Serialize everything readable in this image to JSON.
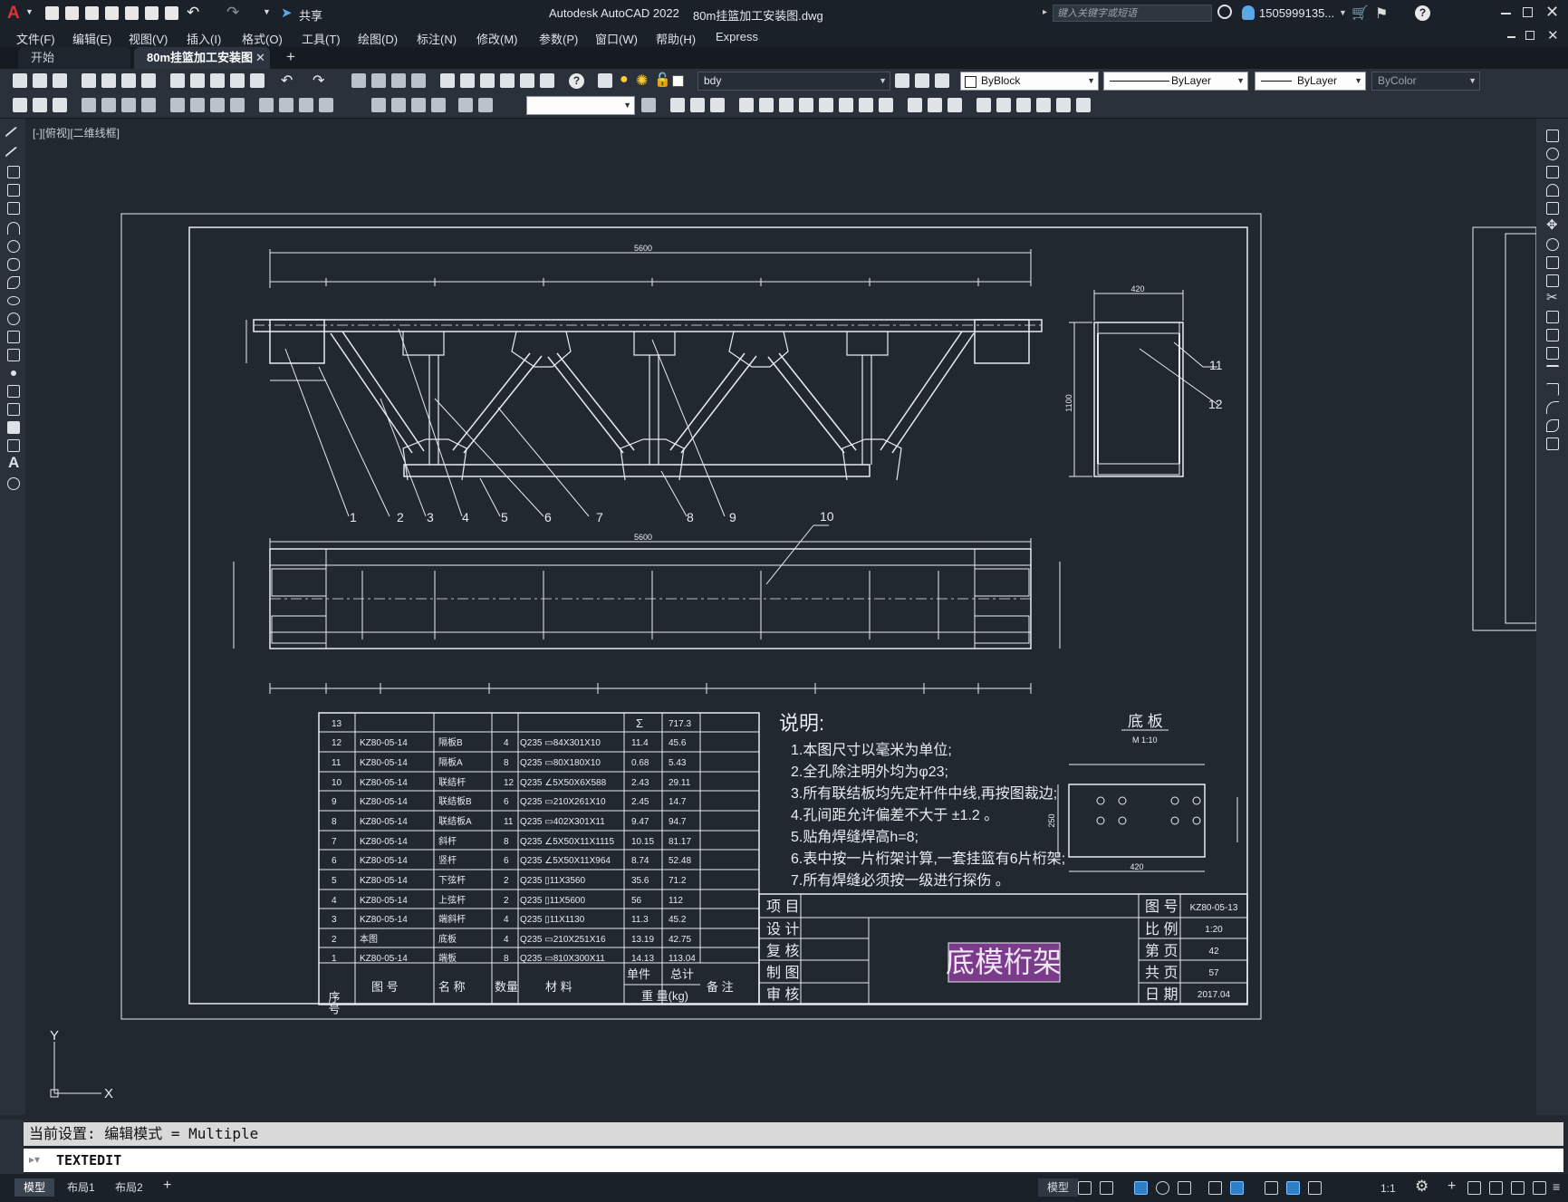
{
  "title_bar": {
    "app_title": "Autodesk AutoCAD 2022",
    "file_name": "80m挂篮加工安装图.dwg",
    "search_placeholder": "键入关键字或短语",
    "user": "1505999135...",
    "share_label": "共享"
  },
  "menu": [
    "文件(F)",
    "编辑(E)",
    "视图(V)",
    "插入(I)",
    "格式(O)",
    "工具(T)",
    "绘图(D)",
    "标注(N)",
    "修改(M)",
    "参数(P)",
    "窗口(W)",
    "帮助(H)",
    "Express"
  ],
  "tabs": {
    "start": "开始",
    "drawing": "80m挂篮加工安装图*"
  },
  "toolbar": {
    "layer_name": "bdy",
    "color": "ByBlock",
    "linetype": "ByLayer",
    "lineweight": "ByLayer",
    "plotstyle": "ByColor"
  },
  "viewport_label": "[-][俯视][二维线框]",
  "drawing": {
    "overall_length": "5600",
    "width_dim": "420",
    "height_dim": "1100",
    "callouts": [
      "1",
      "2",
      "3",
      "4",
      "5",
      "6",
      "7",
      "8",
      "9",
      "10",
      "11",
      "12"
    ],
    "bom": {
      "total_label": "Σ",
      "total_value": "717.3",
      "total_row_no": "13",
      "rows": [
        {
          "no": "12",
          "drawing": "KZ80-05-14",
          "name": "隔板B",
          "qty": "4",
          "material": "Q235 ▭84X301X10",
          "unit": "11.4",
          "total": "45.6"
        },
        {
          "no": "11",
          "drawing": "KZ80-05-14",
          "name": "隔板A",
          "qty": "8",
          "material": "Q235 ▭80X180X10",
          "unit": "0.68",
          "total": "5.43"
        },
        {
          "no": "10",
          "drawing": "KZ80-05-14",
          "name": "联结杆",
          "qty": "12",
          "material": "Q235 ∠5X50X6X588",
          "unit": "2.43",
          "total": "29.11"
        },
        {
          "no": "9",
          "drawing": "KZ80-05-14",
          "name": "联结板B",
          "qty": "6",
          "material": "Q235 ▭210X261X10",
          "unit": "2.45",
          "total": "14.7"
        },
        {
          "no": "8",
          "drawing": "KZ80-05-14",
          "name": "联结板A",
          "qty": "11",
          "material": "Q235 ▭402X301X11",
          "unit": "9.47",
          "total": "94.7"
        },
        {
          "no": "7",
          "drawing": "KZ80-05-14",
          "name": "斜杆",
          "qty": "8",
          "material": "Q235 ∠5X50X11X1115",
          "unit": "10.15",
          "total": "81.17"
        },
        {
          "no": "6",
          "drawing": "KZ80-05-14",
          "name": "竖杆",
          "qty": "6",
          "material": "Q235 ∠5X50X11X964",
          "unit": "8.74",
          "total": "52.48"
        },
        {
          "no": "5",
          "drawing": "KZ80-05-14",
          "name": "下弦杆",
          "qty": "2",
          "material": "Q235 ▯11X3560",
          "unit": "35.6",
          "total": "71.2"
        },
        {
          "no": "4",
          "drawing": "KZ80-05-14",
          "name": "上弦杆",
          "qty": "2",
          "material": "Q235 ▯11X5600",
          "unit": "56",
          "total": "112"
        },
        {
          "no": "3",
          "drawing": "KZ80-05-14",
          "name": "端斜杆",
          "qty": "4",
          "material": "Q235 ▯11X1130",
          "unit": "11.3",
          "total": "45.2"
        },
        {
          "no": "2",
          "drawing": "本图",
          "name": "底板",
          "qty": "4",
          "material": "Q235 ▭210X251X16",
          "unit": "13.19",
          "total": "42.75"
        },
        {
          "no": "1",
          "drawing": "KZ80-05-14",
          "name": "端板",
          "qty": "8",
          "material": "Q235 ▭810X300X11",
          "unit": "14.13",
          "total": "113.04"
        }
      ],
      "headers": {
        "no": "序号",
        "drawing": "图 号",
        "name": "名 称",
        "qty": "数量",
        "material": "材 料",
        "weight_top_unit": "单件",
        "weight_top_total": "总计",
        "weight_bottom": "重 量(kg)",
        "remark": "备 注"
      }
    },
    "notes": {
      "title": "说明:",
      "items": [
        "1.本图尺寸以毫米为单位;",
        "2.全孔除注明外均为φ23;",
        "3.所有联结板均先定杆件中线,再按图裁边;",
        "4.孔间距允许偏差不大于 ±1.2   。",
        "5.贴角焊缝焊高h=8;",
        "6.表中按一片桁架计算,一套挂篮有6片桁架;",
        "7.所有焊缝必须按一级进行探伤 。"
      ]
    },
    "base_plate": {
      "title": "底 板",
      "scale": "M 1:10",
      "dim_width": "420",
      "dim_height": "250"
    },
    "title_block": {
      "left_labels": [
        "项 目",
        "设 计",
        "复 核",
        "制 图",
        "审 核"
      ],
      "main_title": "底模桁架",
      "right_labels": [
        "图 号",
        "比 例",
        "第 页",
        "共 页",
        "日 期"
      ],
      "right_values": [
        "KZ80-05-13",
        "1:20",
        "42",
        "57",
        "2017.04"
      ]
    }
  },
  "ucs": {
    "x": "X",
    "y": "Y"
  },
  "command": {
    "history": "当前设置: 编辑模式 = Multiple",
    "current": "TEXTEDIT"
  },
  "status": {
    "layouts": [
      "模型",
      "布局1",
      "布局2"
    ],
    "model_label": "模型",
    "scale": "1:1"
  }
}
